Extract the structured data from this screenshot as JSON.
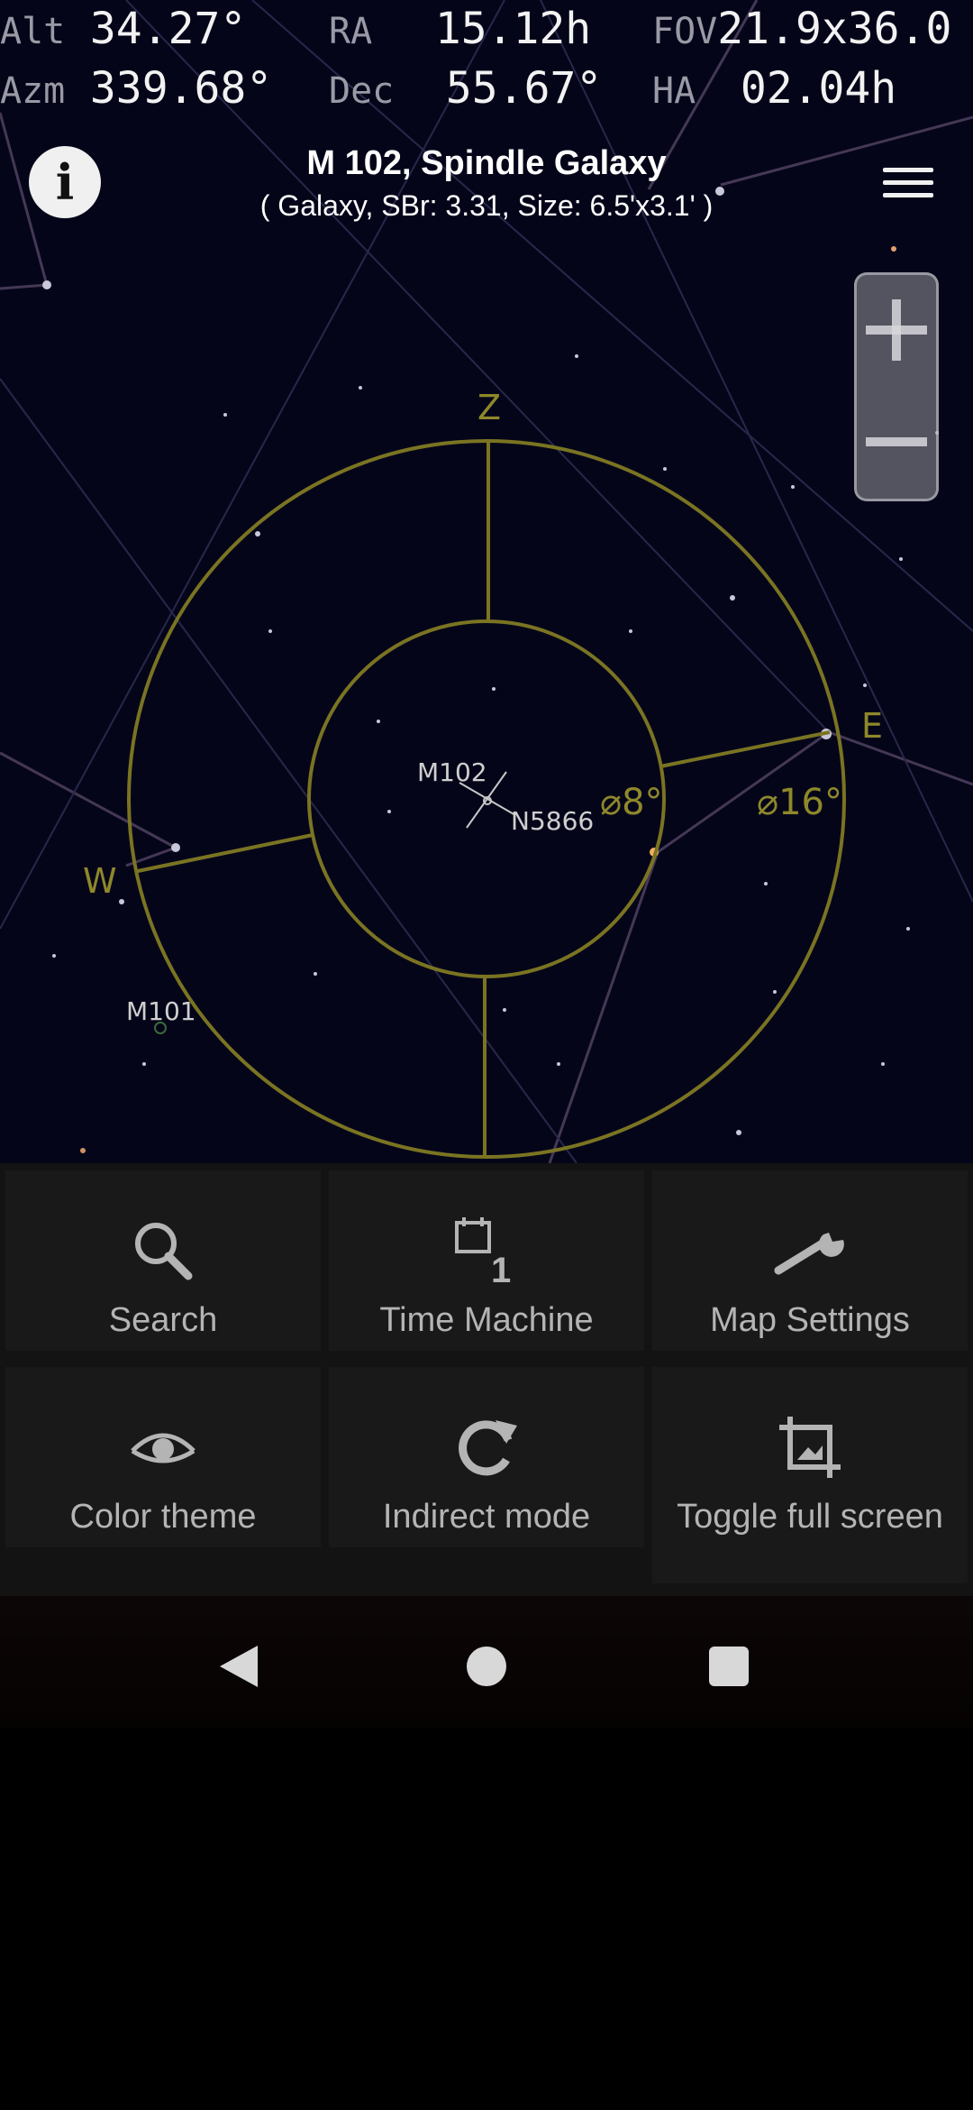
{
  "readouts": {
    "alt": {
      "label": "Alt",
      "value": "34.27°"
    },
    "azm": {
      "label": "Azm",
      "value": "339.68°"
    },
    "ra": {
      "label": "RA",
      "value": "15.12h"
    },
    "dec": {
      "label": "Dec",
      "value": "55.67°"
    },
    "fov": {
      "label": "FOV",
      "value": "21.9x36.0"
    },
    "ha": {
      "label": "HA",
      "value": "02.04h"
    }
  },
  "object": {
    "title": "M 102, Spindle Galaxy",
    "subtitle": "( Galaxy, SBr: 3.31, Size: 6.5'x3.1' )"
  },
  "sky_labels": {
    "zenith": "Z",
    "east": "E",
    "west": "W",
    "inner_circle": "⌀8°",
    "outer_circle": "⌀16°",
    "obj_m102": "M102",
    "obj_n5866": "N5866",
    "obj_m101": "M101"
  },
  "colors": {
    "sky_background": "#05051a",
    "reticle": "#7a7422",
    "reticle_label": "#8e882a",
    "panel": "#131313",
    "tile": "#191919"
  },
  "menu": {
    "search": "Search",
    "time_machine": "Time Machine",
    "time_machine_badge": "1",
    "map_settings": "Map Settings",
    "color_theme": "Color theme",
    "indirect_mode": "Indirect mode",
    "toggle_fullscreen": "Toggle full screen"
  }
}
